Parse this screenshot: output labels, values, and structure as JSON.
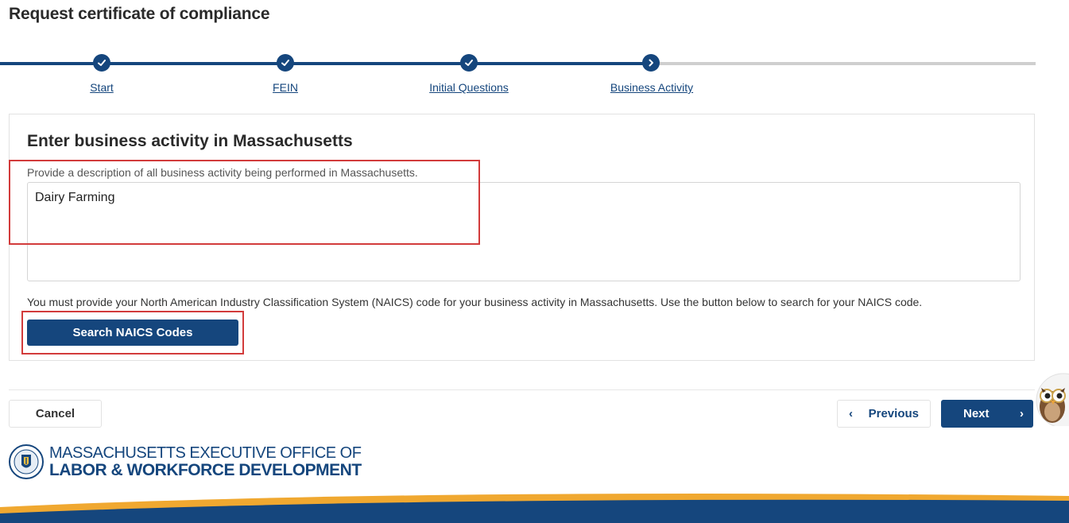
{
  "page": {
    "title": "Request certificate of compliance"
  },
  "stepper": {
    "steps": [
      {
        "label": "Start",
        "status": "complete"
      },
      {
        "label": "FEIN",
        "status": "complete"
      },
      {
        "label": "Initial Questions",
        "status": "complete"
      },
      {
        "label": "Business Activity",
        "status": "current"
      }
    ]
  },
  "form": {
    "heading": "Enter business activity in Massachusetts",
    "description": "Provide a description of all business activity being performed in Massachusetts.",
    "activity_value": "Dairy Farming",
    "naics_note": "You must provide your North American Industry Classification System (NAICS) code for your business activity in Massachusetts. Use the button below to search for your NAICS code.",
    "naics_button": "Search NAICS Codes"
  },
  "footer_nav": {
    "cancel": "Cancel",
    "previous": "Previous",
    "next": "Next"
  },
  "branding": {
    "line1": "MASSACHUSETTS EXECUTIVE OFFICE OF",
    "line2": "LABOR & WORKFORCE DEVELOPMENT"
  },
  "colors": {
    "primary": "#15467d",
    "highlight": "#d23b3b",
    "swoosh_gold": "#f0a830",
    "swoosh_blue": "#15467d"
  }
}
